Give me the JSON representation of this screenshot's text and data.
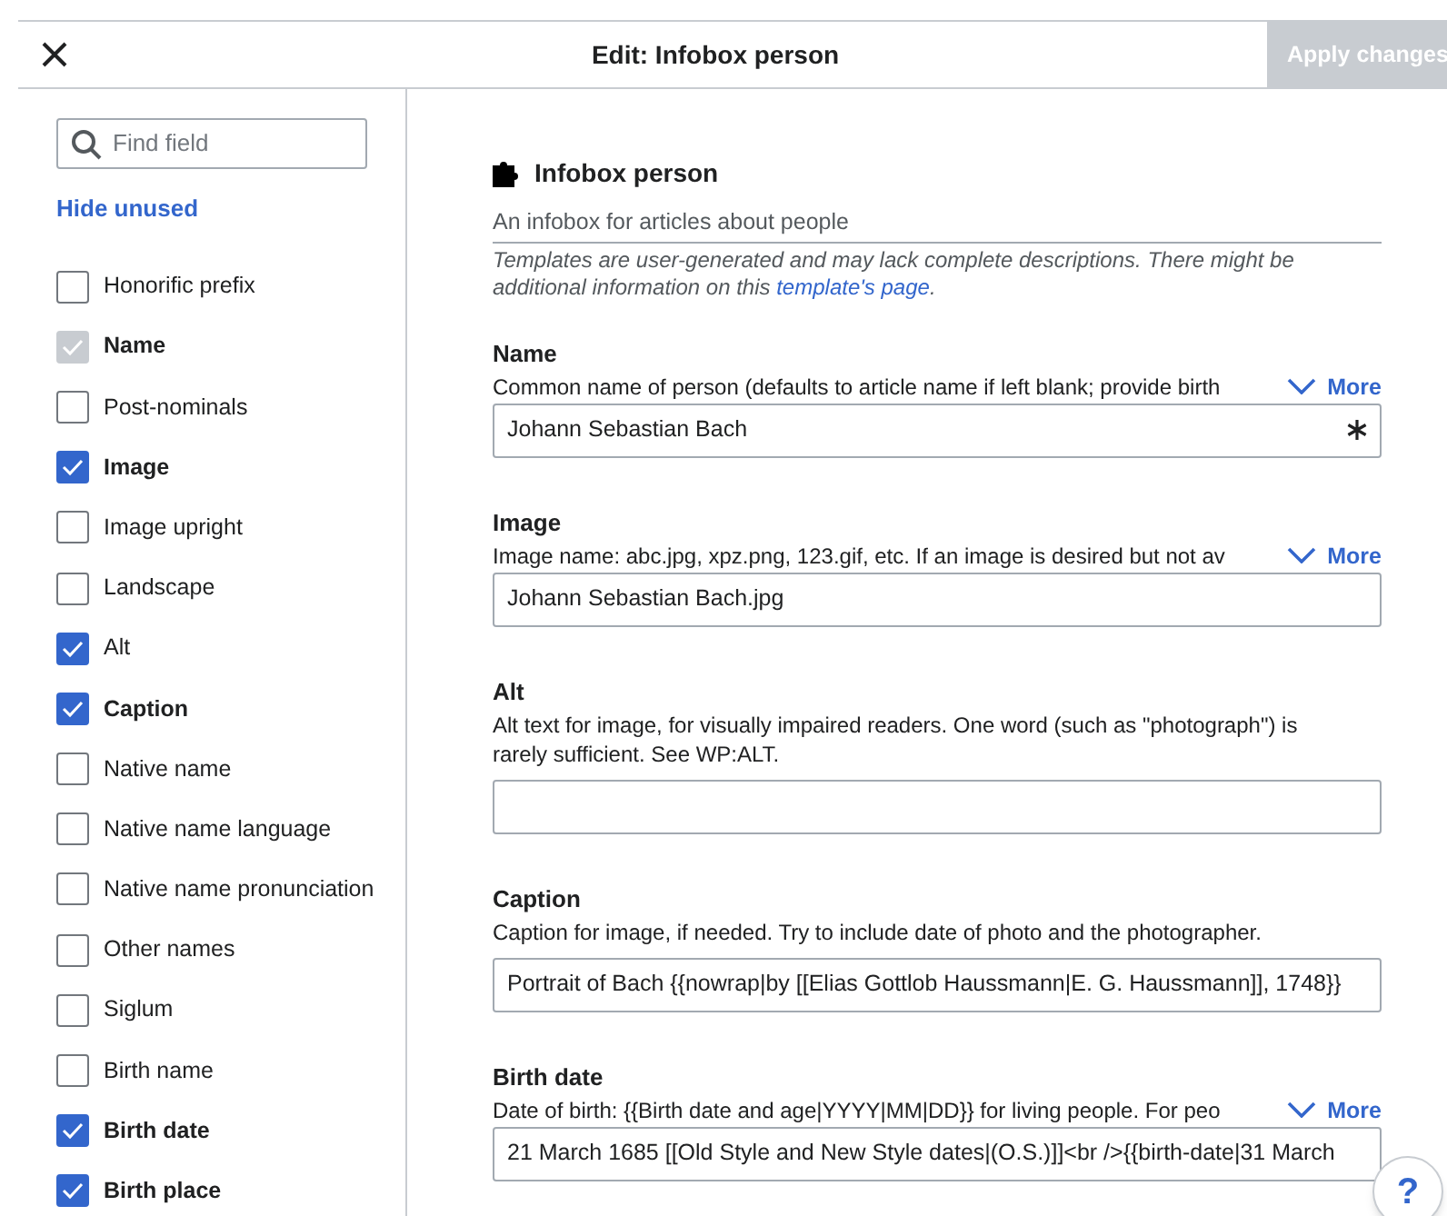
{
  "dialog": {
    "title": "Edit: Infobox person",
    "apply_button": {
      "label": "Apply changes",
      "disabled": true
    },
    "help_button": "?"
  },
  "sidebar": {
    "search": {
      "placeholder": "Find field"
    },
    "hide_unused": "Hide unused",
    "fields": [
      {
        "label": "Honorific prefix",
        "checked": false,
        "emphasized": false,
        "disabled": false
      },
      {
        "label": "Name",
        "checked": true,
        "emphasized": true,
        "disabled": true
      },
      {
        "label": "Post-nominals",
        "checked": false,
        "emphasized": false,
        "disabled": false
      },
      {
        "label": "Image",
        "checked": true,
        "emphasized": true,
        "disabled": false
      },
      {
        "label": "Image upright",
        "checked": false,
        "emphasized": false,
        "disabled": false
      },
      {
        "label": "Landscape",
        "checked": false,
        "emphasized": false,
        "disabled": false
      },
      {
        "label": "Alt",
        "checked": true,
        "emphasized": false,
        "disabled": false
      },
      {
        "label": "Caption",
        "checked": true,
        "emphasized": true,
        "disabled": false
      },
      {
        "label": "Native name",
        "checked": false,
        "emphasized": false,
        "disabled": false
      },
      {
        "label": "Native name language",
        "checked": false,
        "emphasized": false,
        "disabled": false
      },
      {
        "label": "Native name pronunciation",
        "checked": false,
        "emphasized": false,
        "disabled": false
      },
      {
        "label": "Other names",
        "checked": false,
        "emphasized": false,
        "disabled": false
      },
      {
        "label": "Siglum",
        "checked": false,
        "emphasized": false,
        "disabled": false
      },
      {
        "label": "Birth name",
        "checked": false,
        "emphasized": false,
        "disabled": false
      },
      {
        "label": "Birth date",
        "checked": true,
        "emphasized": true,
        "disabled": false
      },
      {
        "label": "Birth place",
        "checked": true,
        "emphasized": true,
        "disabled": false
      }
    ]
  },
  "template": {
    "name": "Infobox person",
    "description": "An infobox for articles about people",
    "note_before": "Templates are user-generated and may lack complete descriptions. There might be additional information on this ",
    "note_link": "template's page",
    "note_after": "."
  },
  "params": [
    {
      "label": "Name",
      "description": "Common name of person (defaults to article name if left blank; provide birth",
      "more": "More",
      "value": "Johann Sebastian Bach",
      "required": true,
      "kind": "line"
    },
    {
      "label": "Image",
      "description": "Image name: abc.jpg, xpz.png, 123.gif, etc. If an image is desired but not av",
      "more": "More",
      "value": "Johann Sebastian Bach.jpg",
      "kind": "line"
    },
    {
      "label": "Alt",
      "description": "Alt text for image, for visually impaired readers. One word (such as \"photograph\") is rarely sufficient. See WP:ALT.",
      "kind": "line"
    },
    {
      "label": "Caption",
      "description": "Caption for image, if needed. Try to include date of photo and the photographer.",
      "value": "Portrait of Bach {{nowrap|by [[Elias Gottlob Haussmann|E. G. Haussmann]], 1748}}",
      "kind": "multiline"
    },
    {
      "label": "Birth date",
      "description": "Date of birth: {{Birth date and age|YYYY|MM|DD}} for living people. For peo",
      "more": "More",
      "value": "21 March 1685 [[Old Style and New Style dates|(O.S.)]]<br />{{birth-date|31 March",
      "kind": "multiline"
    }
  ]
}
